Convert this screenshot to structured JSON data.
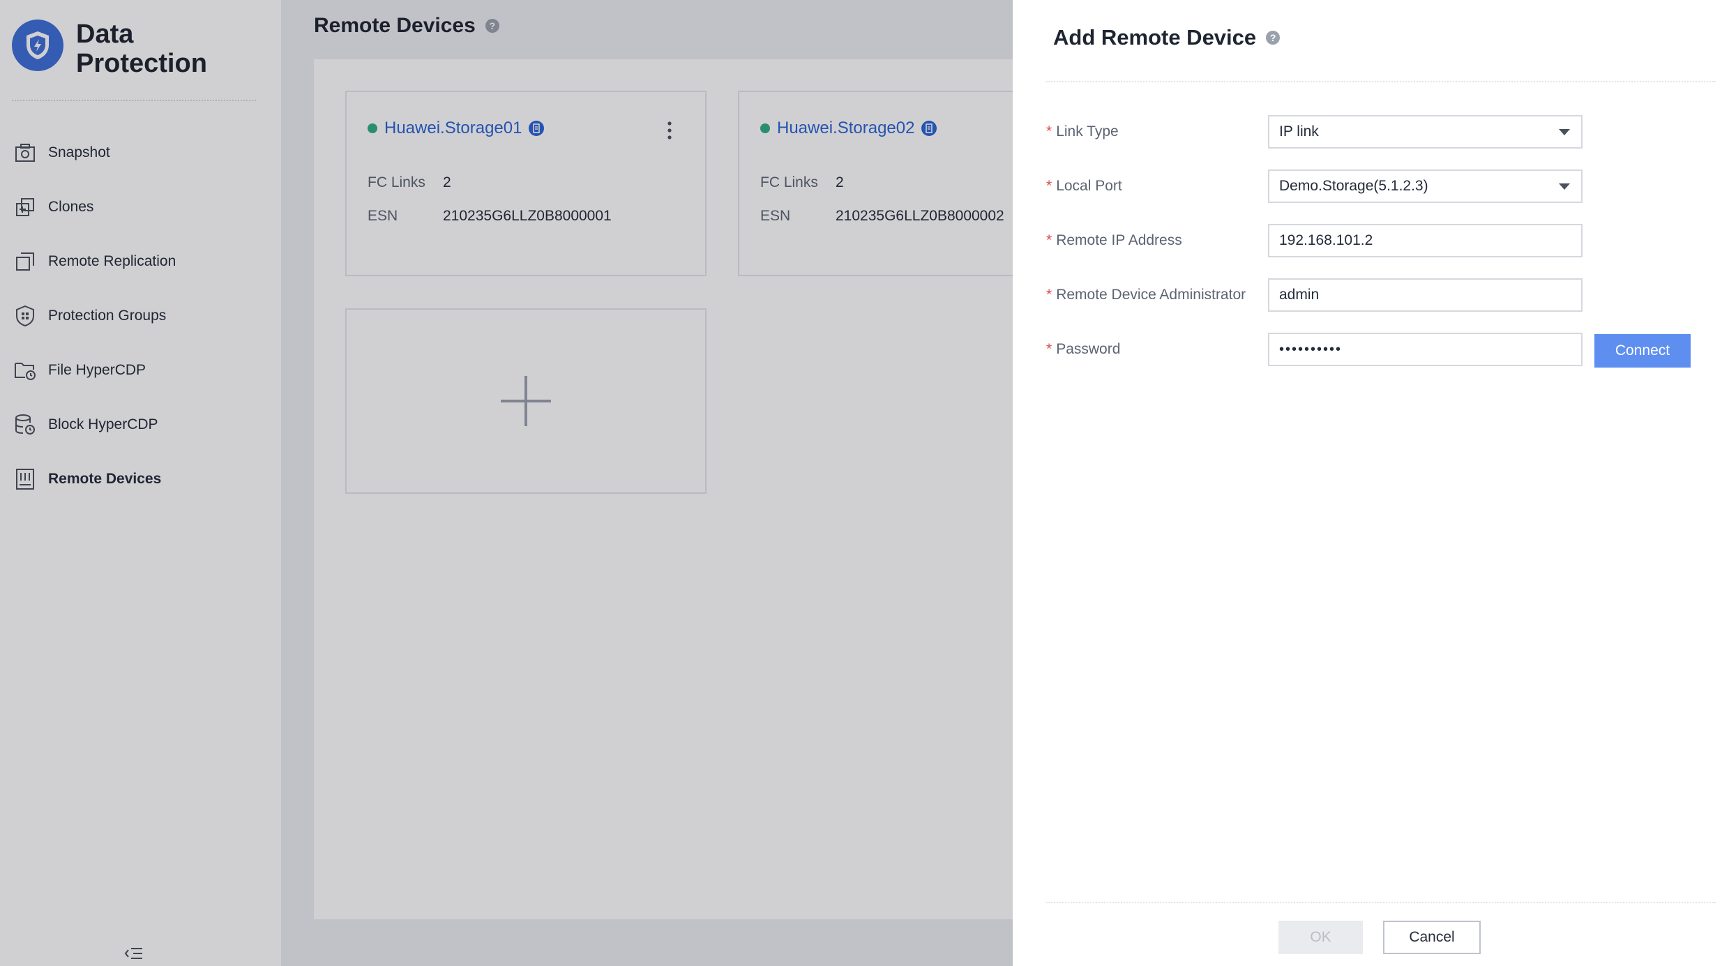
{
  "app": {
    "title": "Data Protection"
  },
  "sidebar": {
    "items": [
      {
        "label": "Snapshot",
        "icon": "camera-icon"
      },
      {
        "label": "Clones",
        "icon": "clone-icon"
      },
      {
        "label": "Remote Replication",
        "icon": "replication-icon"
      },
      {
        "label": "Protection Groups",
        "icon": "shield-group-icon"
      },
      {
        "label": "File HyperCDP",
        "icon": "folder-clock-icon"
      },
      {
        "label": "Block HyperCDP",
        "icon": "database-clock-icon"
      },
      {
        "label": "Remote Devices",
        "icon": "device-icon",
        "active": true
      }
    ]
  },
  "main": {
    "title": "Remote Devices",
    "devices": [
      {
        "name": "Huawei.Storage01",
        "status": "online",
        "fc_links_label": "FC Links",
        "fc_links": "2",
        "esn_label": "ESN",
        "esn": "210235G6LLZ0B8000001"
      },
      {
        "name": "Huawei.Storage02",
        "status": "online",
        "fc_links_label": "FC Links",
        "fc_links": "2",
        "esn_label": "ESN",
        "esn": "210235G6LLZ0B8000002"
      }
    ]
  },
  "drawer": {
    "title": "Add Remote Device",
    "fields": {
      "link_type": {
        "label": "Link Type",
        "value": "IP link"
      },
      "local_port": {
        "label": "Local Port",
        "value": "Demo.Storage(5.1.2.3)"
      },
      "remote_ip": {
        "label": "Remote IP Address",
        "value": "192.168.101.2"
      },
      "admin": {
        "label": "Remote Device Administrator",
        "value": "admin"
      },
      "password": {
        "label": "Password",
        "value": "••••••••••"
      }
    },
    "required_mark": "*",
    "connect_label": "Connect",
    "ok_label": "OK",
    "cancel_label": "Cancel"
  },
  "colors": {
    "accent": "#2a63d6",
    "primary_button": "#5e8ff0",
    "status_online": "#2fad84",
    "required": "#e04a4a"
  }
}
